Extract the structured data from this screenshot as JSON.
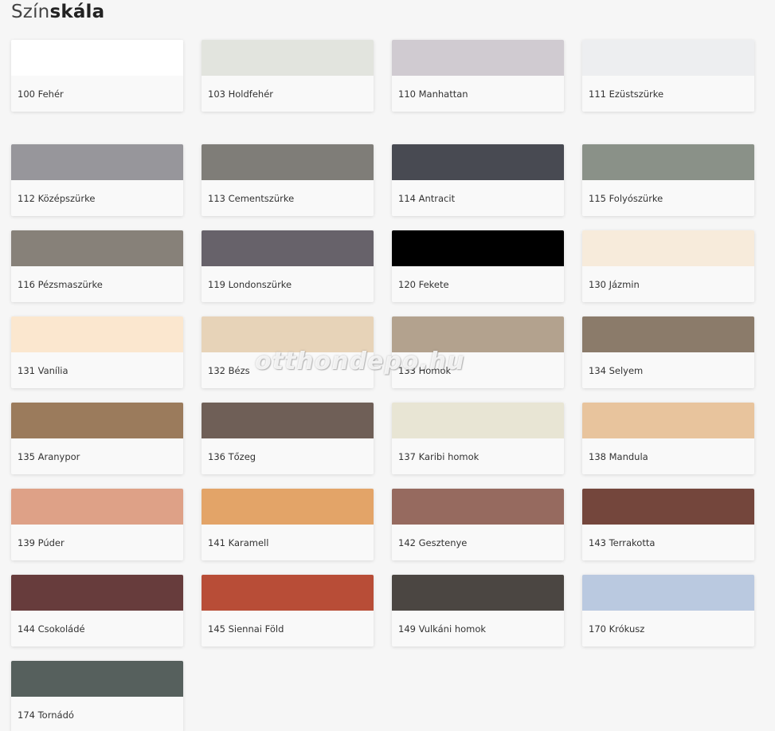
{
  "header": {
    "title_light": "Szín",
    "title_bold": "skála"
  },
  "watermark": "otthondepo.hu",
  "swatches": [
    {
      "label": "100 Fehér",
      "color": "#ffffff"
    },
    {
      "label": "103 Holdfehér",
      "color": "#e2e4de"
    },
    {
      "label": "110 Manhattan",
      "color": "#d0cbd1"
    },
    {
      "label": "111 Ezüstszürke",
      "color": "#edeef0"
    },
    {
      "label": "112 Középszürke",
      "color": "#97969b"
    },
    {
      "label": "113 Cementszürke",
      "color": "#7f7d78"
    },
    {
      "label": "114 Antracit",
      "color": "#484a52"
    },
    {
      "label": "115 Folyószürke",
      "color": "#8a9188"
    },
    {
      "label": "116 Pézsmaszürke",
      "color": "#878179"
    },
    {
      "label": "119 Londonszürke",
      "color": "#67626a"
    },
    {
      "label": "120 Fekete",
      "color": "#000000"
    },
    {
      "label": "130 Jázmin",
      "color": "#f7ebdb"
    },
    {
      "label": "131 Vanília",
      "color": "#fbe7cf"
    },
    {
      "label": "132 Bézs",
      "color": "#e7d3b8"
    },
    {
      "label": "133 Homok",
      "color": "#b3a28e"
    },
    {
      "label": "134 Selyem",
      "color": "#8b7b6a"
    },
    {
      "label": "135 Aranypor",
      "color": "#9b7b5c"
    },
    {
      "label": "136 Tőzeg",
      "color": "#6f5f57"
    },
    {
      "label": "137 Karibi homok",
      "color": "#e8e5d4"
    },
    {
      "label": "138 Mandula",
      "color": "#e8c49d"
    },
    {
      "label": "139 Púder",
      "color": "#dea187"
    },
    {
      "label": "141 Karamell",
      "color": "#e3a468"
    },
    {
      "label": "142 Gesztenye",
      "color": "#966a5f"
    },
    {
      "label": "143 Terrakotta",
      "color": "#74463c"
    },
    {
      "label": "144 Csokoládé",
      "color": "#673c3c"
    },
    {
      "label": "145 Siennai Föld",
      "color": "#b84d37"
    },
    {
      "label": "149 Vulkáni homok",
      "color": "#4b4642"
    },
    {
      "label": "170 Krókusz",
      "color": "#bac9e0"
    },
    {
      "label": "174 Tornádó",
      "color": "#56605d"
    }
  ]
}
